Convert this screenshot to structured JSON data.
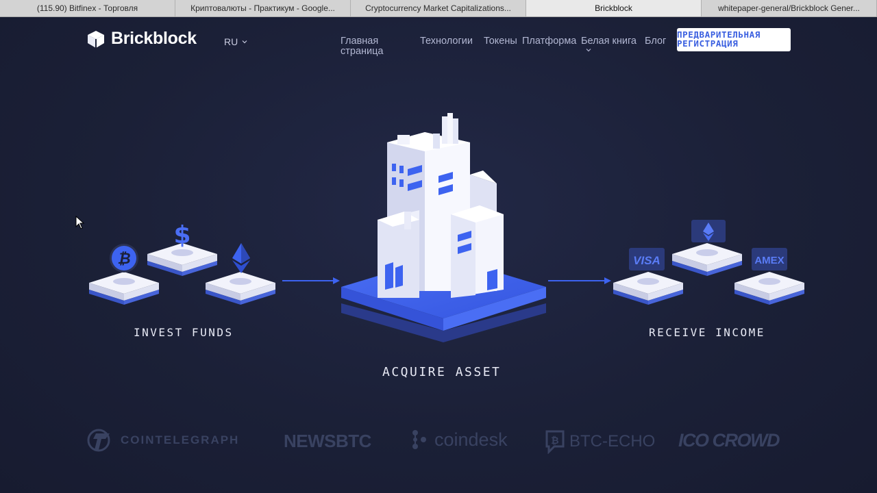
{
  "browser": {
    "tabs": [
      {
        "label": "(115.90) Bitfinex - Торговля",
        "active": false
      },
      {
        "label": "Криптовалюты - Практикум - Google...",
        "active": false
      },
      {
        "label": "Cryptocurrency Market Capitalizations...",
        "active": false
      },
      {
        "label": "Brickblock",
        "active": true
      },
      {
        "label": "whitepaper-general/Brickblock Gener...",
        "active": false
      }
    ]
  },
  "header": {
    "brand": "Brickblock",
    "language": "RU",
    "nav": {
      "home": "Главная страница",
      "technologies": "Технологии",
      "tokens": "Токены",
      "platform": "Платформа",
      "whitepaper": "Белая книга",
      "blog": "Блог"
    },
    "cta": "ПРЕДВАРИТЕЛЬНАЯ РЕГИСТРАЦИЯ"
  },
  "illustration": {
    "invest_label": "INVEST FUNDS",
    "acquire_label": "ACQUIRE ASSET",
    "income_label": "RECEIVE INCOME",
    "invest_icons": [
      "bitcoin-icon",
      "dollar-icon",
      "ethereum-icon"
    ],
    "income_icons": {
      "card1": "VISA",
      "card2": "AMEX",
      "crypto": "ethereum-icon"
    }
  },
  "press": [
    "COINTELEGRAPH",
    "NEWSBTC",
    "coindesk",
    "BTC-ECHO",
    "ICO CROWD"
  ],
  "colors": {
    "background": "#1b2037",
    "accent": "#3d63f0",
    "platform_light": "#eef0fb",
    "press_logo": "#394261"
  }
}
